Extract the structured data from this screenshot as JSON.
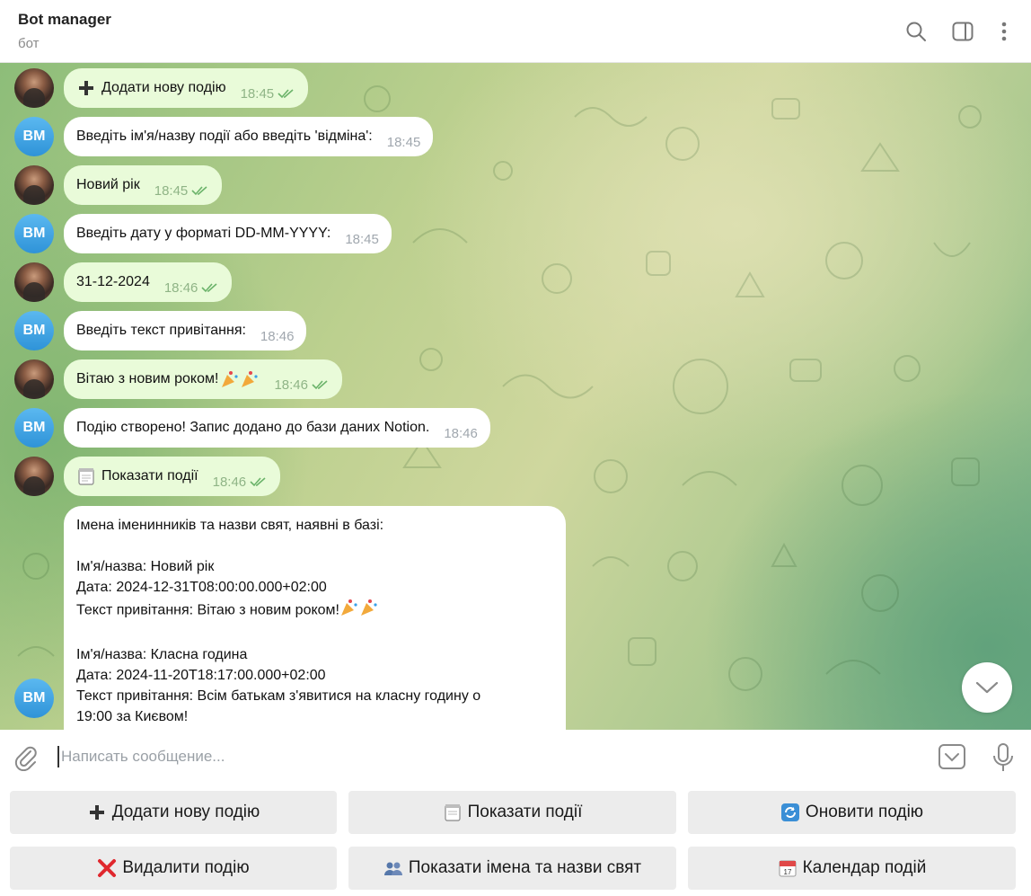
{
  "header": {
    "title": "Bot manager",
    "subtitle": "бот"
  },
  "messages": [
    {
      "dir": "out",
      "text": "Додати нову подію",
      "time": "18:45",
      "icon": "plus-icon"
    },
    {
      "dir": "in",
      "sender": "BM",
      "text": "Введіть ім'я/назву події або введіть 'відміна':",
      "time": "18:45"
    },
    {
      "dir": "out",
      "text": "Новий рік",
      "time": "18:45"
    },
    {
      "dir": "in",
      "sender": "BM",
      "text": "Введіть дату у форматі DD-MM-YYYY:",
      "time": "18:45"
    },
    {
      "dir": "out",
      "text": "31-12-2024",
      "time": "18:46"
    },
    {
      "dir": "in",
      "sender": "BM",
      "text": "Введіть текст привітання:",
      "time": "18:46"
    },
    {
      "dir": "out",
      "text": "Вітаю з новим роком!",
      "time": "18:46",
      "emoji": "party-popper-icon"
    },
    {
      "dir": "in",
      "sender": "BM",
      "text": "Подію створено! Запис додано до бази даних Notion.",
      "time": "18:46"
    },
    {
      "dir": "out",
      "text": "Показати події",
      "time": "18:46",
      "icon": "notepad-icon"
    }
  ],
  "list_message": {
    "sender": "BM",
    "heading": "Імена іменинників та назви свят, наявні в базі:",
    "entries": [
      {
        "name": "Ім'я/назва: Новий рік",
        "date": "Дата: 2024-12-31T08:00:00.000+02:00",
        "greeting": "Текст привітання: Вітаю з новим роком!"
      },
      {
        "name": "Ім'я/назва: Класна година",
        "date": "Дата: 2024-11-20T18:17:00.000+02:00",
        "greeting": "Текст привітання: Всім батькам з'явитися на класну годину о",
        "greeting_cont": "19:00 за Києвом!"
      }
    ]
  },
  "composer": {
    "placeholder": "Написать сообщение..."
  },
  "keyboard": [
    {
      "label": "Додати нову подію",
      "icon": "plus-icon"
    },
    {
      "label": "Показати події",
      "icon": "notepad-icon"
    },
    {
      "label": "Оновити подію",
      "icon": "refresh-icon"
    },
    {
      "label": "Видалити подію",
      "icon": "red-cross-icon"
    },
    {
      "label": "Показати імена та назви свят",
      "icon": "people-icon"
    },
    {
      "label": "Календар подій",
      "icon": "calendar-icon"
    }
  ],
  "colors": {
    "outgoing_bubble": "#e9fbd9",
    "incoming_bubble": "#ffffff",
    "avatar_bm": "#3ea6e5",
    "ticks": "#6bb36a"
  }
}
